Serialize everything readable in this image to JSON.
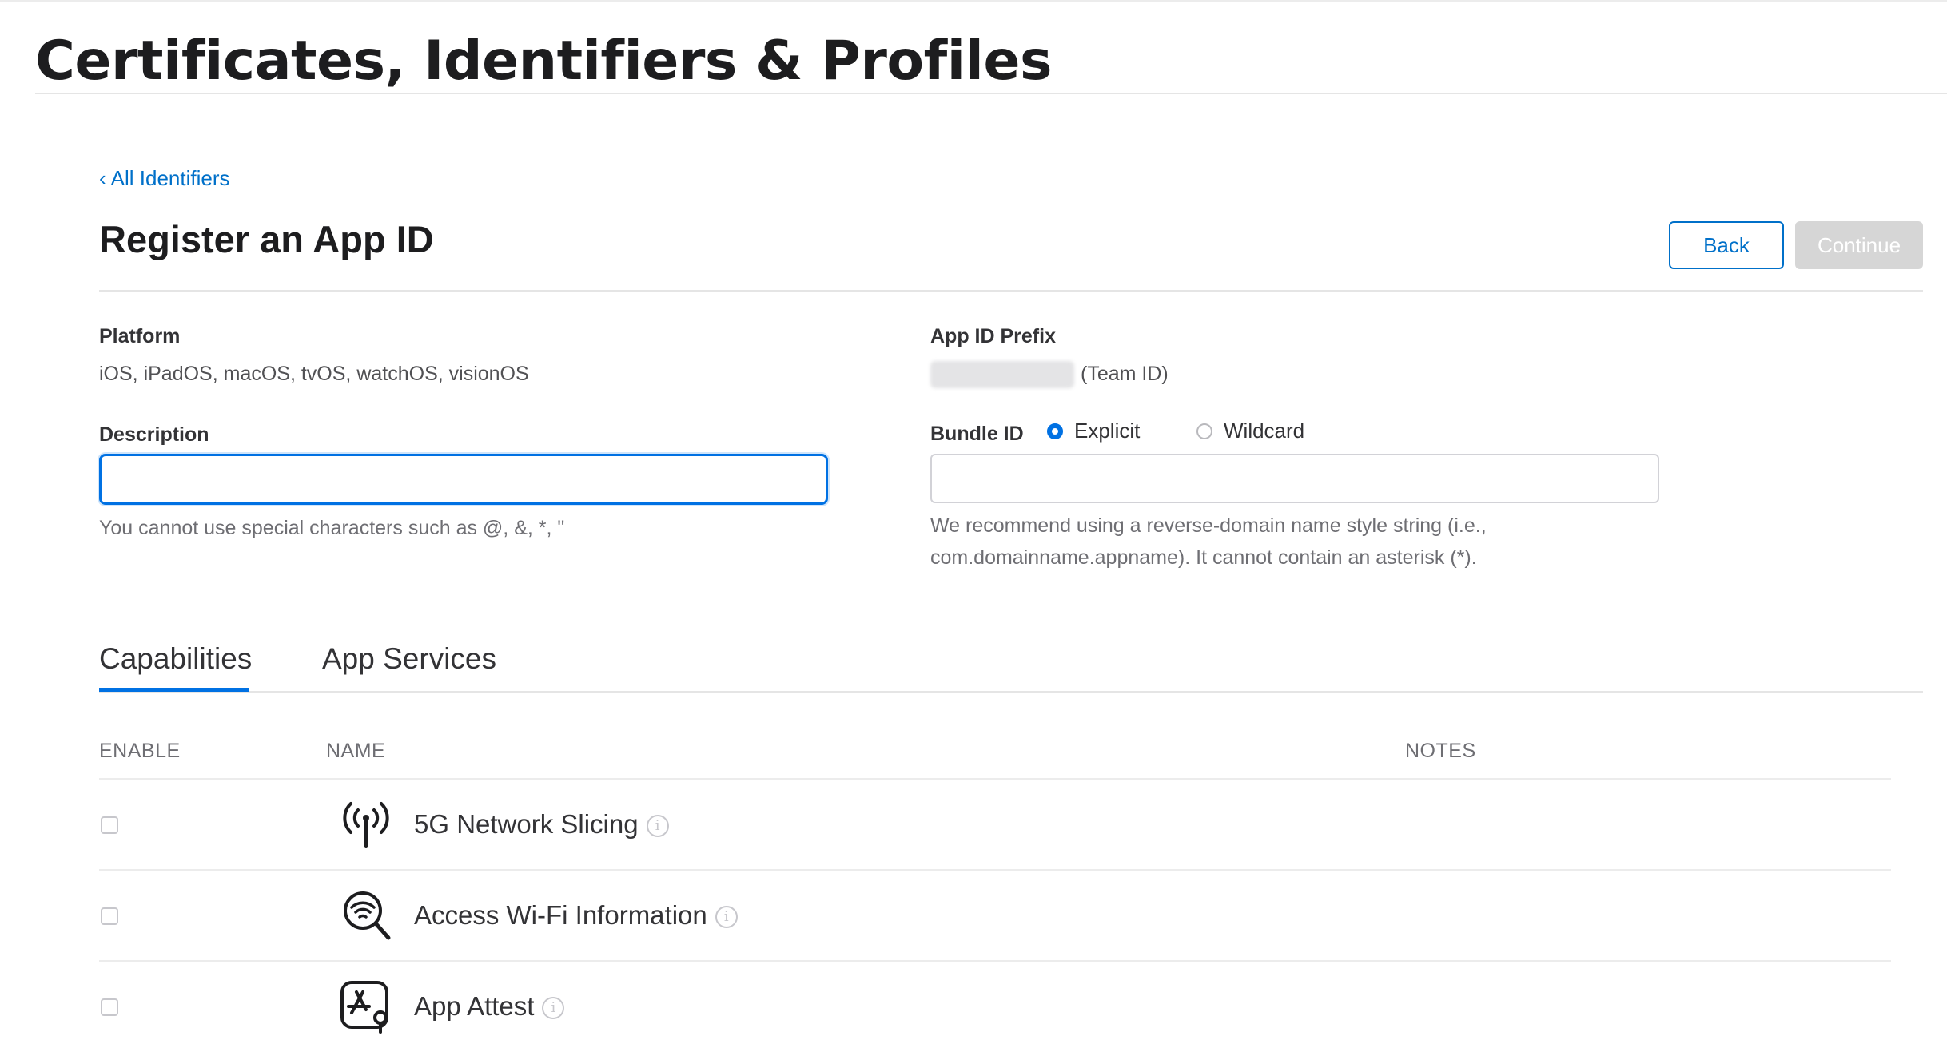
{
  "header": {
    "title": "Certificates, Identifiers & Profiles"
  },
  "breadcrumb": {
    "chevron": "‹",
    "label": "All Identifiers"
  },
  "section": {
    "title": "Register an App ID"
  },
  "buttons": {
    "back": "Back",
    "continue": "Continue"
  },
  "platform": {
    "label": "Platform",
    "value": "iOS, iPadOS, macOS, tvOS, watchOS, visionOS"
  },
  "app_id_prefix": {
    "label": "App ID Prefix",
    "suffix": "(Team ID)"
  },
  "description": {
    "label": "Description",
    "value": "",
    "placeholder": "",
    "hint": "You cannot use special characters such as @, &, *, \""
  },
  "bundle_id": {
    "label": "Bundle ID",
    "options": [
      {
        "label": "Explicit",
        "selected": true
      },
      {
        "label": "Wildcard",
        "selected": false
      }
    ],
    "value": "",
    "hint_line1": "We recommend using a reverse-domain name style string (i.e.,",
    "hint_line2": "com.domainname.appname). It cannot contain an asterisk (*)."
  },
  "tabs": [
    {
      "label": "Capabilities",
      "active": true
    },
    {
      "label": "App Services",
      "active": false
    }
  ],
  "table": {
    "columns": {
      "enable": "ENABLE",
      "name": "NAME",
      "notes": "NOTES"
    },
    "rows": [
      {
        "name": "5G Network Slicing",
        "icon": "antenna-icon",
        "enabled": false
      },
      {
        "name": "Access Wi-Fi Information",
        "icon": "wifi-search-icon",
        "enabled": false
      },
      {
        "name": "App Attest",
        "icon": "app-attest-icon",
        "enabled": false
      }
    ]
  },
  "colors": {
    "accent": "#0071e3",
    "link": "#0070c9",
    "disabled_button": "#d6d6d6"
  }
}
